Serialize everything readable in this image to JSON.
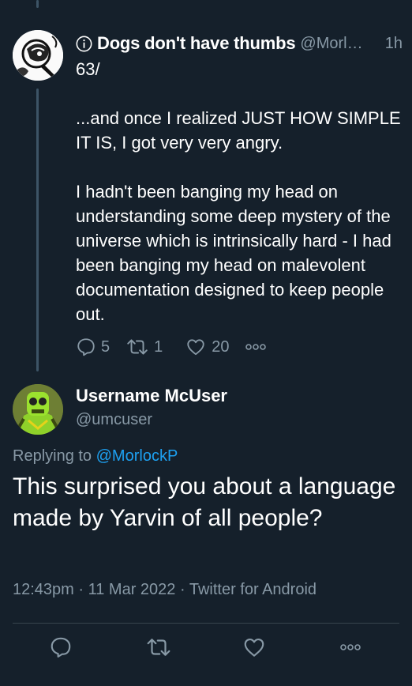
{
  "parent_tweet": {
    "display_name": "Dogs don't have thumbs",
    "handle": "@Morl…",
    "time": "1h",
    "text": "63/\n\n...and once I realized JUST HOW SIMPLE IT IS, I got very very angry.\n\nI hadn't been banging my head on understanding some deep mystery of the universe which is intrinsically hard - I had been banging my head on malevolent documentation designed to keep people out.",
    "replies": "5",
    "retweets": "1",
    "likes": "20",
    "icons": [
      "info-icon",
      "reply-icon",
      "retweet-icon",
      "like-icon",
      "more-icon"
    ]
  },
  "reply_tweet": {
    "display_name": "Username McUser",
    "handle": "@umcuser",
    "replying_prefix": "Replying to ",
    "replying_to": "@MorlockP",
    "text": "This surprised you about a language made by Yarvin of all people?",
    "timestamp": "12:43pm · 11 Mar 2022 · Twitter for Android"
  },
  "bottom_bar": {
    "icons": [
      "reply-icon",
      "retweet-icon",
      "like-icon",
      "more-icon"
    ]
  },
  "colors": {
    "background": "#15202b",
    "text": "#ffffff",
    "secondary": "#8899a6",
    "link": "#1da1f2",
    "thread_line": "#3d5466",
    "divider": "#38444d"
  }
}
